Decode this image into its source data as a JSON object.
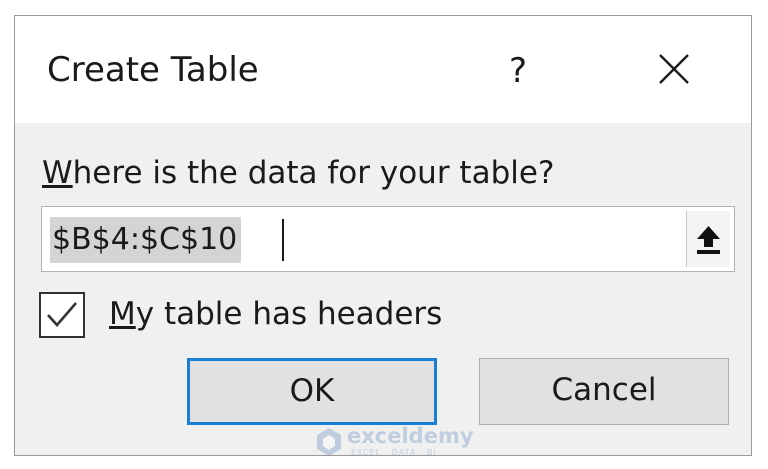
{
  "dialog": {
    "title": "Create Table",
    "help_label": "?",
    "close_icon": "close-icon"
  },
  "range": {
    "prompt_prefix": "",
    "prompt_accel": "W",
    "prompt_rest": "here is the data for your table?",
    "value": "$B$4:$C$10",
    "collapse_icon": "collapse-dialog-icon"
  },
  "headers_checkbox": {
    "checked": true,
    "label_accel": "M",
    "label_rest": "y table has headers"
  },
  "buttons": {
    "ok_label": "OK",
    "cancel_label": "Cancel"
  },
  "watermark": {
    "name": "exceldemy",
    "tagline": "EXCEL · DATA · BI"
  },
  "colors": {
    "focus_accent": "#1c7fd6",
    "dialog_body": "#f0f0f0",
    "selection_highlight": "#d4d4d4"
  }
}
